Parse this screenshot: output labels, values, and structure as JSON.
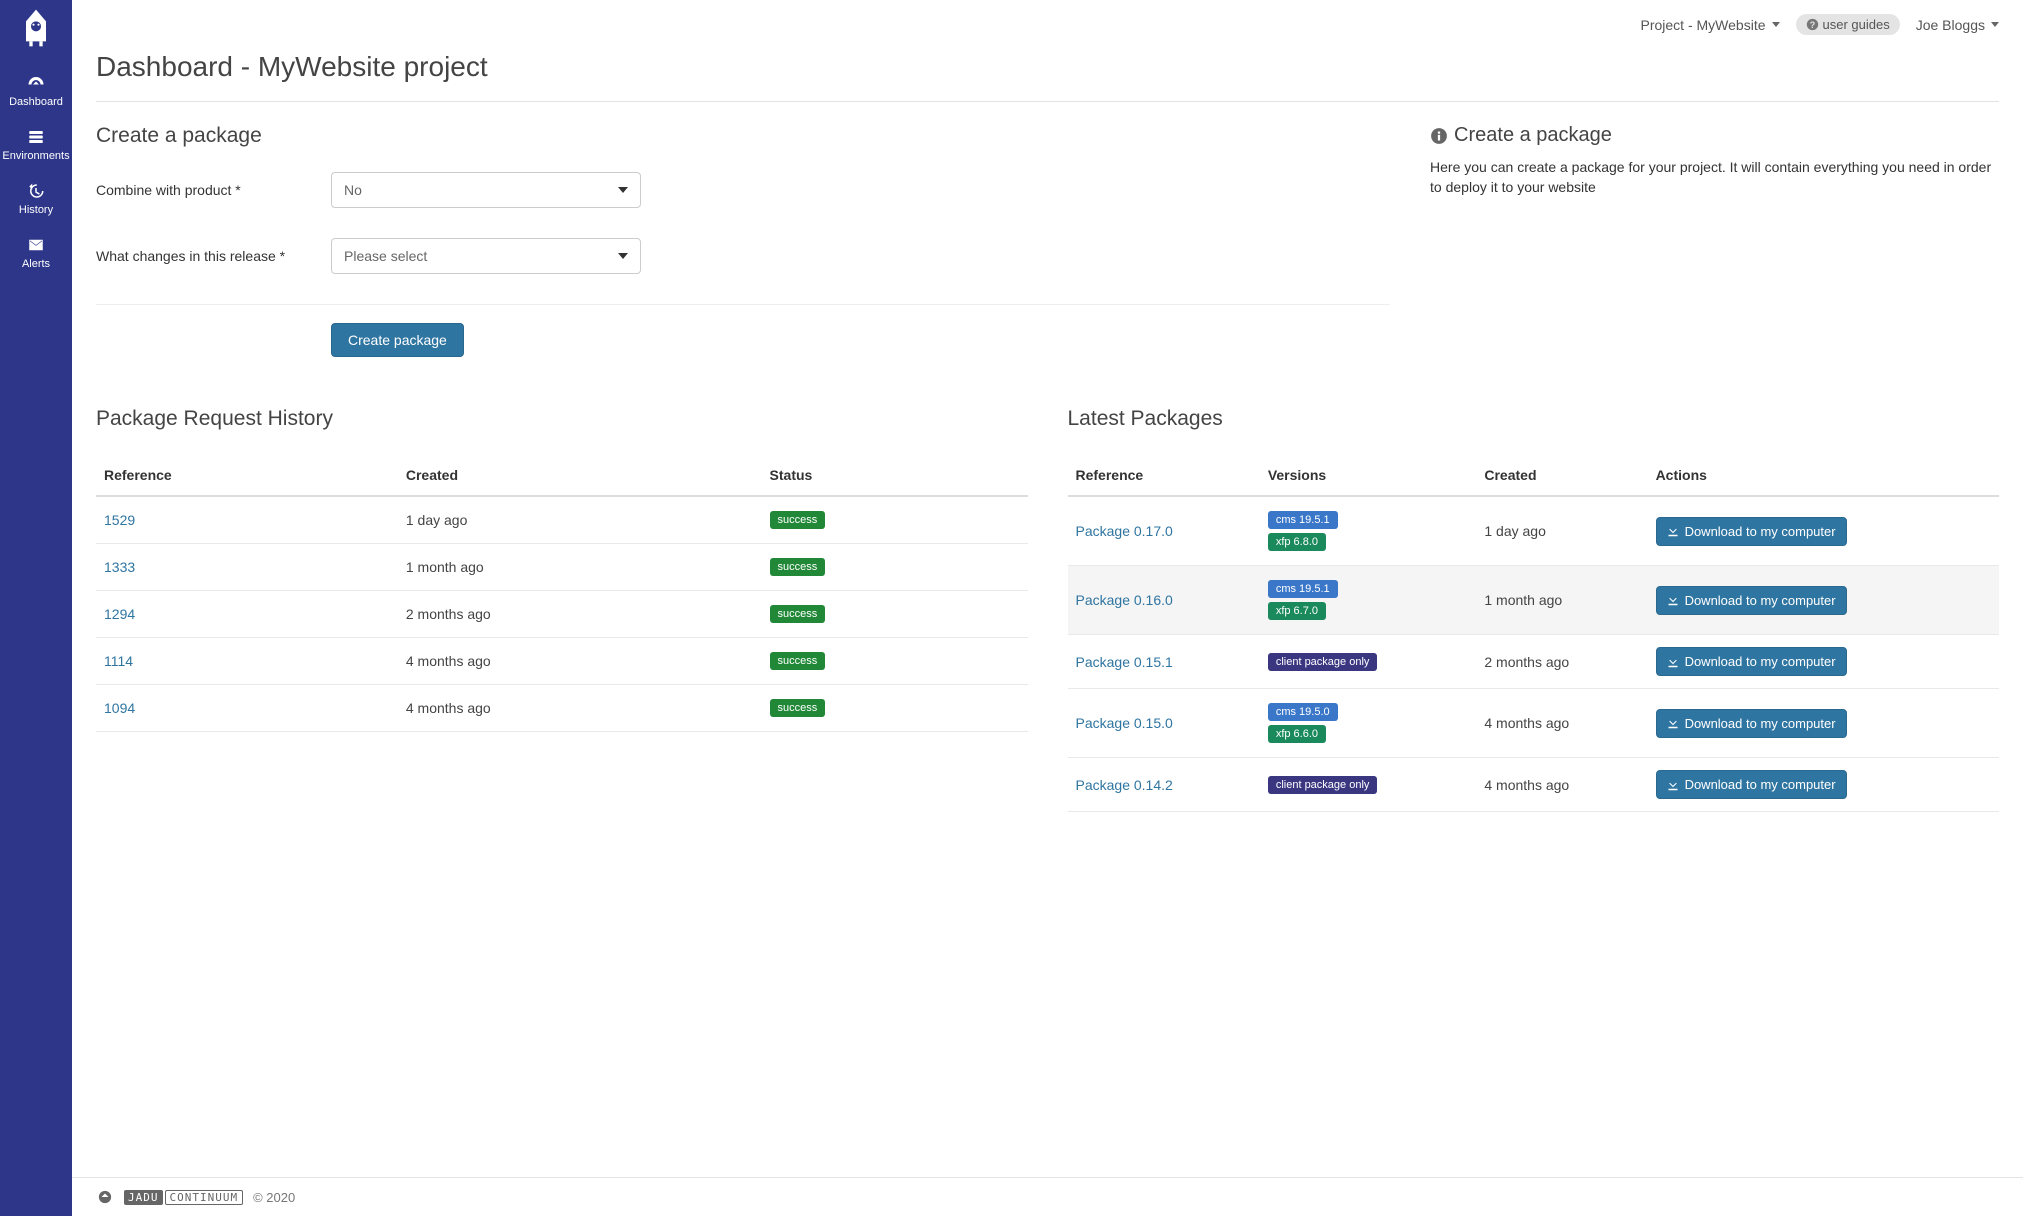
{
  "sidebar": {
    "items": [
      {
        "label": "Dashboard"
      },
      {
        "label": "Environments"
      },
      {
        "label": "History"
      },
      {
        "label": "Alerts"
      }
    ]
  },
  "topbar": {
    "project_label": "Project - MyWebsite",
    "guides_label": "user guides",
    "user_label": "Joe Bloggs"
  },
  "page": {
    "title": "Dashboard - MyWebsite project"
  },
  "create_package": {
    "title": "Create a package",
    "combine_label": "Combine with product *",
    "combine_value": "No",
    "changes_label": "What changes in this release *",
    "changes_value": "Please select",
    "submit_label": "Create package"
  },
  "info": {
    "title": "Create a package",
    "body": "Here you can create a package for your project. It will contain everything you need in order to deploy it to your website"
  },
  "history": {
    "title": "Package Request History",
    "columns": {
      "reference": "Reference",
      "created": "Created",
      "status": "Status"
    },
    "rows": [
      {
        "reference": "1529",
        "created": "1 day ago",
        "status": "success"
      },
      {
        "reference": "1333",
        "created": "1 month ago",
        "status": "success"
      },
      {
        "reference": "1294",
        "created": "2 months ago",
        "status": "success"
      },
      {
        "reference": "1114",
        "created": "4 months ago",
        "status": "success"
      },
      {
        "reference": "1094",
        "created": "4 months ago",
        "status": "success"
      }
    ]
  },
  "latest": {
    "title": "Latest Packages",
    "columns": {
      "reference": "Reference",
      "versions": "Versions",
      "created": "Created",
      "actions": "Actions"
    },
    "download_label": "Download to my computer",
    "rows": [
      {
        "reference": "Package 0.17.0",
        "versions": [
          {
            "text": "cms 19.5.1",
            "style": "blue"
          },
          {
            "text": "xfp 6.8.0",
            "style": "green"
          }
        ],
        "created": "1 day ago",
        "highlight": false
      },
      {
        "reference": "Package 0.16.0",
        "versions": [
          {
            "text": "cms 19.5.1",
            "style": "blue"
          },
          {
            "text": "xfp 6.7.0",
            "style": "green"
          }
        ],
        "created": "1 month ago",
        "highlight": true
      },
      {
        "reference": "Package 0.15.1",
        "versions": [
          {
            "text": "client package only",
            "style": "purple"
          }
        ],
        "created": "2 months ago",
        "highlight": false
      },
      {
        "reference": "Package 0.15.0",
        "versions": [
          {
            "text": "cms 19.5.0",
            "style": "blue"
          },
          {
            "text": "xfp 6.6.0",
            "style": "green"
          }
        ],
        "created": "4 months ago",
        "highlight": false
      },
      {
        "reference": "Package 0.14.2",
        "versions": [
          {
            "text": "client package only",
            "style": "purple"
          }
        ],
        "created": "4 months ago",
        "highlight": false
      }
    ]
  },
  "footer": {
    "brand1": "JADU",
    "brand2": "CONTINUUM",
    "copyright": "© 2020"
  }
}
